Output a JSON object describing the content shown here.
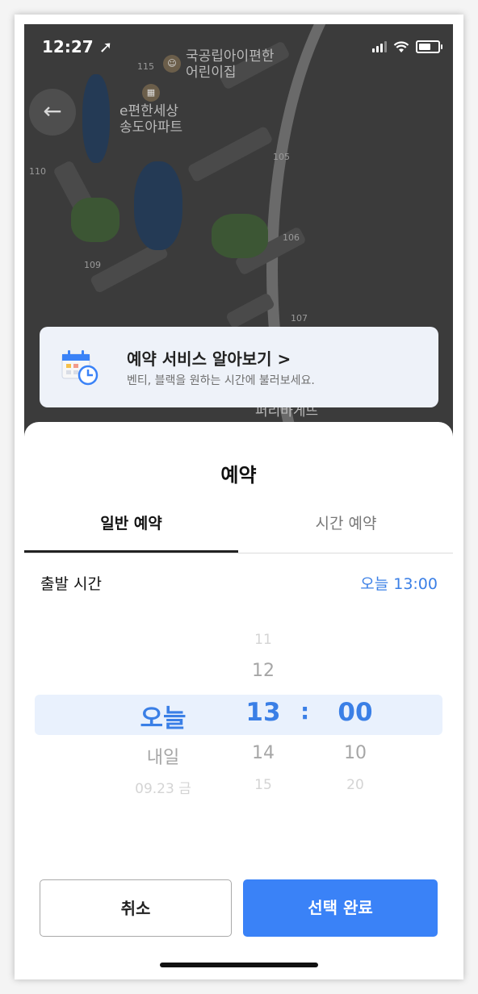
{
  "status_bar": {
    "time": "12:27 ➚"
  },
  "map": {
    "labels": [
      "115",
      "105",
      "110",
      "106",
      "109",
      "107"
    ],
    "poi_1": "국공립아이편한\n어린이집",
    "poi_2": "e편한세상\n송도아파트",
    "poi_3": "퍼리바게뜨"
  },
  "promo": {
    "title": "예약 서비스 알아보기 >",
    "subtitle": "벤티, 블랙을 원하는 시간에 불러보세요."
  },
  "sheet": {
    "title": "예약",
    "tabs": [
      {
        "label": "일반 예약",
        "active": true
      },
      {
        "label": "시간 예약",
        "active": false
      }
    ],
    "departure_label": "출발 시간",
    "departure_value": "오늘 13:00"
  },
  "picker": {
    "day": {
      "selected": "오늘",
      "next1": "내일",
      "next2": "09.23 금"
    },
    "hour": {
      "prev2": "11",
      "prev1": "12",
      "selected": "13",
      "next1": "14",
      "next2": "15"
    },
    "colon": ":",
    "minute": {
      "selected": "00",
      "next1": "10",
      "next2": "20"
    }
  },
  "buttons": {
    "cancel": "취소",
    "confirm": "선택 완료"
  },
  "colors": {
    "accent": "#3a7fe6",
    "confirm_bg": "#3a82f7",
    "highlight_bg": "#e9f1fd"
  }
}
